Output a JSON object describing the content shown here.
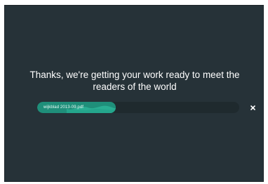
{
  "message": {
    "line1": "Thanks, we're getting your work ready to meet the",
    "line2": "readers of the world"
  },
  "upload": {
    "file_name": "wijkblad 2013-09.pdf",
    "progress": 0.39,
    "close_icon": "close-icon"
  },
  "colors": {
    "background": "#263238",
    "progress_track": "#1f2a2e",
    "progress_fill": "#1f8f7a",
    "wave_highlight": "#2fb89c",
    "text": "#ffffff"
  }
}
